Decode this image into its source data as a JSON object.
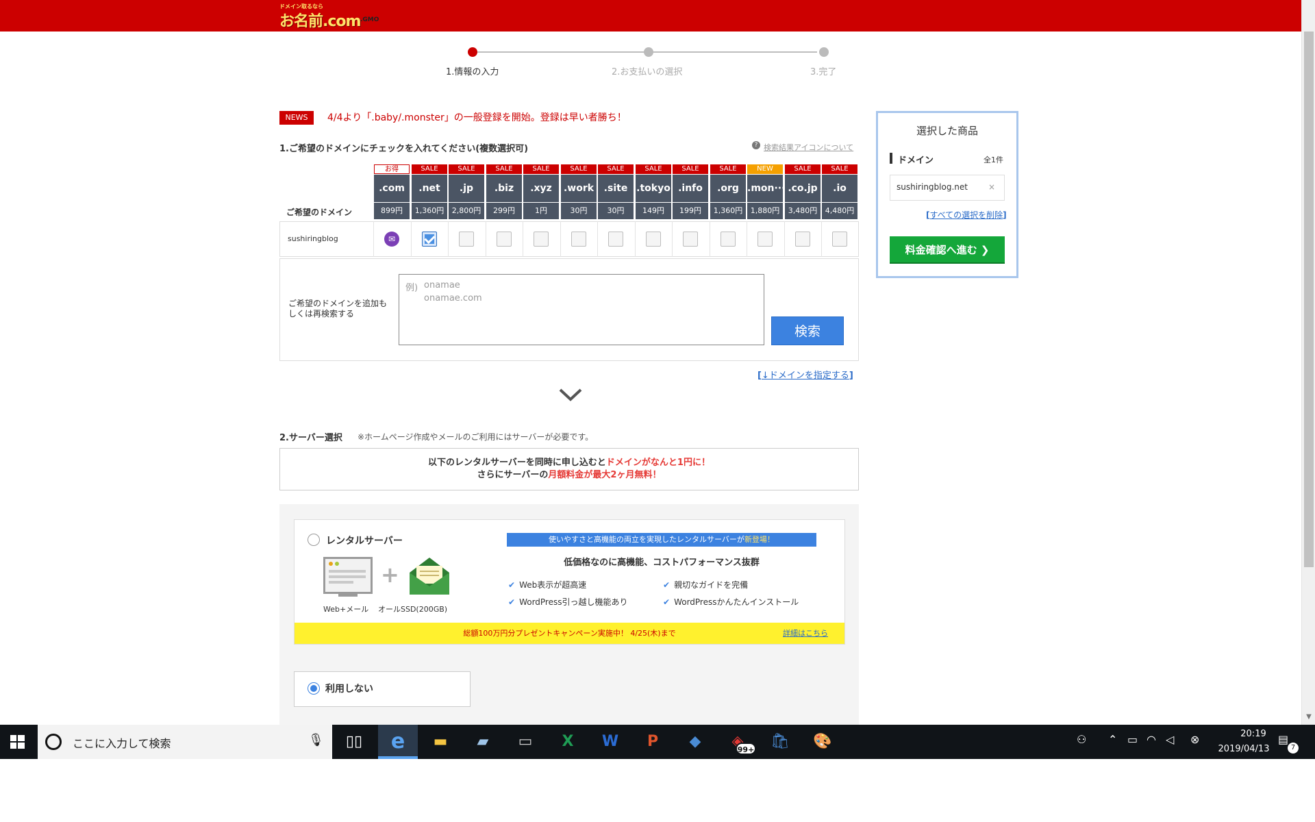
{
  "header": {
    "logo_tag": "ドメイン取るなら",
    "logo_main": "お名前.com",
    "logo_sub": ".GMO"
  },
  "steps": [
    {
      "label": "1.情報の入力",
      "active": true
    },
    {
      "label": "2.お支払いの選択",
      "active": false
    },
    {
      "label": "3.完了",
      "active": false
    }
  ],
  "news": {
    "badge": "NEWS",
    "text": "4/4より「.baby/.monster」の一般登録を開始。登録は早い者勝ち！"
  },
  "section1": {
    "title": "1.ご希望のドメインにチェックを入れてください(複数選択可)",
    "legend_icon": "?",
    "legend_link": "検索結果アイコンについて",
    "col_label": "ご希望のドメイン",
    "row_domain": "sushiringblog",
    "tlds": [
      {
        "badge": "お得",
        "name": ".com",
        "price": "899円"
      },
      {
        "badge": "SALE",
        "name": ".net",
        "price": "1,360円"
      },
      {
        "badge": "SALE",
        "name": ".jp",
        "price": "2,800円"
      },
      {
        "badge": "SALE",
        "name": ".biz",
        "price": "299円"
      },
      {
        "badge": "SALE",
        "name": ".xyz",
        "price": "1円"
      },
      {
        "badge": "SALE",
        "name": ".work",
        "price": "30円"
      },
      {
        "badge": "SALE",
        "name": ".site",
        "price": "30円"
      },
      {
        "badge": "SALE",
        "name": ".tokyo",
        "price": "149円"
      },
      {
        "badge": "SALE",
        "name": ".info",
        "price": "199円"
      },
      {
        "badge": "SALE",
        "name": ".org",
        "price": "1,360円"
      },
      {
        "badge": "NEW",
        "name": ".mon···",
        "price": "1,880円"
      },
      {
        "badge": "SALE",
        "name": ".co.jp",
        "price": "3,480円"
      },
      {
        "badge": "SALE",
        "name": ".io",
        "price": "4,480円"
      }
    ],
    "checked": [
      false,
      true,
      false,
      false,
      false,
      false,
      false,
      false,
      false,
      false,
      false,
      false,
      false
    ],
    "search_label": "ご希望のドメインを追加もしくは再検索する",
    "placeholder_ex": "例)",
    "placeholder_1": "onamae",
    "placeholder_2": "onamae.com",
    "search_button": "検索",
    "specify_open": "[",
    "specify_link": "↓ドメインを指定する",
    "specify_close": "]"
  },
  "section2": {
    "title": "2.サーバー選択",
    "note": "※ホームページ作成やメールのご利用にはサーバーが必要です。",
    "notice_l1a": "以下のレンタルサーバーを同時に申し込むと",
    "notice_l1b": "ドメインがなんと1円に！",
    "notice_l2a": "さらにサーバーの",
    "notice_l2b": "月額料金が最大2ヶ月無料！",
    "rental_title": "レンタルサーバー",
    "cap_web": "Web+メール",
    "cap_ssd": "オールSSD(200GB)",
    "banner_a": "使いやすさと高機能の両立を実現したレンタルサーバーが",
    "banner_b": "新登場！",
    "feature_head": "低価格なのに高機能、コストパフォーマンス抜群",
    "features": [
      "Web表示が超高速",
      "親切なガイドを完備",
      "WordPress引っ越し機能あり",
      "WordPressかんたんインストール"
    ],
    "campaign": "総額100万円分プレゼントキャンペーン実施中！ 4/25(木)まで",
    "campaign_link": "詳細はこちら",
    "nouse_label": "利用しない",
    "selected": "nouse"
  },
  "cart": {
    "title": "選択した商品",
    "domain_label": "ドメイン",
    "count": "全1件",
    "item": "sushiringblog.net",
    "remove": "×",
    "clear_open": "[",
    "clear_link": "すべての選択を削除",
    "clear_close": "]",
    "proceed": "料金確認へ進む ❯"
  },
  "taskbar": {
    "search_placeholder": "ここに入力して検索",
    "badge": "99+",
    "time": "20:19",
    "date": "2019/04/13",
    "notifications": "7"
  },
  "colors": {
    "brand_red": "#cc0000",
    "table_dark": "#4b5564",
    "primary_blue": "#3c82e0",
    "proceed_green": "#14a73a",
    "campaign_yellow": "#fff12e"
  }
}
